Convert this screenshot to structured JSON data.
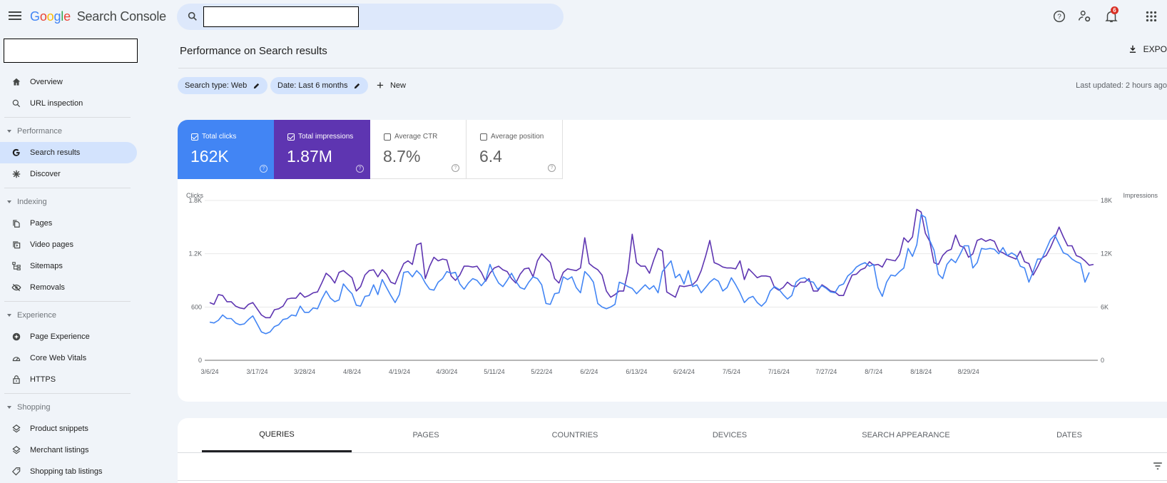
{
  "app": {
    "logo_letters": [
      "G",
      "o",
      "o",
      "g",
      "l",
      "e"
    ],
    "product_name": "Search Console",
    "search_placeholder": "",
    "notification_count": "6"
  },
  "icons": {
    "menu": "hamburger-menu-icon",
    "search": "search-icon",
    "help": "help-circle-icon",
    "account_settings": "account-settings-icon",
    "notifications": "bell-icon",
    "apps": "apps-grid-icon"
  },
  "sidebar": {
    "property_selector_value": "",
    "groups": [
      {
        "section": null,
        "items": [
          {
            "label": "Overview",
            "icon": "home-icon"
          },
          {
            "label": "URL inspection",
            "icon": "search-icon"
          }
        ]
      },
      {
        "section": "Performance",
        "items": [
          {
            "label": "Search results",
            "icon": "google-g-icon",
            "active": true
          },
          {
            "label": "Discover",
            "icon": "asterisk-icon"
          }
        ]
      },
      {
        "section": "Indexing",
        "items": [
          {
            "label": "Pages",
            "icon": "pages-icon"
          },
          {
            "label": "Video pages",
            "icon": "video-pages-icon"
          },
          {
            "label": "Sitemaps",
            "icon": "sitemap-icon"
          },
          {
            "label": "Removals",
            "icon": "eye-off-icon"
          }
        ]
      },
      {
        "section": "Experience",
        "items": [
          {
            "label": "Page Experience",
            "icon": "page-experience-icon"
          },
          {
            "label": "Core Web Vitals",
            "icon": "gauge-icon"
          },
          {
            "label": "HTTPS",
            "icon": "lock-icon"
          }
        ]
      },
      {
        "section": "Shopping",
        "items": [
          {
            "label": "Product snippets",
            "icon": "layers-icon"
          },
          {
            "label": "Merchant listings",
            "icon": "layers-icon"
          },
          {
            "label": "Shopping tab listings",
            "icon": "tag-icon"
          }
        ]
      }
    ]
  },
  "header": {
    "title": "Performance on Search results",
    "export_label": "EXPO",
    "last_updated": "Last updated: 2 hours ago"
  },
  "filters": {
    "chips": [
      {
        "label": "Search type: Web"
      },
      {
        "label": "Date: Last 6 months"
      }
    ],
    "new_label": "New"
  },
  "metrics": [
    {
      "label": "Total clicks",
      "value": "162K",
      "checked": true,
      "color": "#4285f4"
    },
    {
      "label": "Total impressions",
      "value": "1.87M",
      "checked": true,
      "color": "#5e35b1"
    },
    {
      "label": "Average CTR",
      "value": "8.7%",
      "checked": false
    },
    {
      "label": "Average position",
      "value": "6.4",
      "checked": false
    }
  ],
  "chart_data": {
    "type": "line",
    "title": "",
    "y_left_label": "Clicks",
    "y_right_label": "Impressions",
    "y_left_ticks": [
      "0",
      "600",
      "1.2K",
      "1.8K"
    ],
    "y_right_ticks": [
      "0",
      "6K",
      "12K",
      "18K"
    ],
    "ylim_left": [
      0,
      1800
    ],
    "ylim_right": [
      0,
      18000
    ],
    "x_tick_labels": [
      "3/6/24",
      "3/17/24",
      "3/28/24",
      "4/8/24",
      "4/19/24",
      "4/30/24",
      "5/11/24",
      "5/22/24",
      "6/2/24",
      "6/13/24",
      "6/24/24",
      "7/5/24",
      "7/16/24",
      "7/27/24",
      "8/7/24",
      "8/18/24",
      "8/29/24"
    ],
    "x_start": "3/6/24",
    "grid": true,
    "series": [
      {
        "name": "Clicks",
        "axis": "left",
        "color": "#4285f4",
        "values": [
          430,
          420,
          450,
          510,
          470,
          470,
          420,
          400,
          410,
          460,
          500,
          410,
          320,
          300,
          320,
          380,
          400,
          460,
          470,
          510,
          500,
          610,
          540,
          540,
          590,
          580,
          690,
          780,
          700,
          660,
          680,
          860,
          800,
          750,
          620,
          610,
          720,
          730,
          850,
          740,
          910,
          820,
          730,
          650,
          740,
          990,
          1000,
          940,
          1010,
          960,
          870,
          800,
          790,
          880,
          920,
          1000,
          980,
          990,
          860,
          800,
          870,
          920,
          900,
          840,
          900,
          1080,
          960,
          870,
          830,
          900,
          980,
          890,
          820,
          800,
          880,
          940,
          920,
          850,
          640,
          630,
          750,
          760,
          940,
          910,
          940,
          820,
          760,
          1000,
          950,
          880,
          640,
          600,
          580,
          600,
          630,
          880,
          860,
          830,
          810,
          750,
          800,
          850,
          800,
          840,
          760,
          1000,
          1060,
          1120,
          930,
          970,
          860,
          1010,
          830,
          850,
          760,
          820,
          880,
          920,
          890,
          780,
          820,
          930,
          850,
          760,
          650,
          700,
          720,
          650,
          610,
          660,
          780,
          830,
          800,
          740,
          690,
          730,
          880,
          920,
          930,
          890,
          880,
          800,
          840,
          810,
          770,
          760,
          840,
          860,
          950,
          990,
          1050,
          1080,
          1100,
          1060,
          1080,
          820,
          720,
          880,
          960,
          950,
          1000,
          1040,
          1260,
          1170,
          1300,
          1640,
          1610,
          1350,
          1240,
          970,
          920,
          1080,
          1140,
          1100,
          1190,
          1290,
          1290,
          1040,
          1100,
          1260,
          1250,
          1260,
          1250,
          1200,
          1270,
          1180,
          1210,
          1180,
          1060,
          1040,
          880,
          1000,
          1140,
          1140,
          1250,
          1360,
          1410,
          1310,
          1210,
          1190,
          1140,
          1110,
          1090,
          880,
          990
        ]
      },
      {
        "name": "Impressions",
        "axis": "right",
        "color": "#5e35b1",
        "values": [
          6500,
          6300,
          7400,
          7300,
          6600,
          6600,
          6100,
          5900,
          5800,
          6300,
          6500,
          5800,
          5100,
          4800,
          4800,
          5700,
          5800,
          6100,
          6900,
          7000,
          7000,
          7600,
          7100,
          7300,
          7600,
          7700,
          8700,
          9800,
          9400,
          8700,
          9900,
          10100,
          9700,
          9300,
          7800,
          8300,
          9600,
          10100,
          10200,
          9400,
          10200,
          9700,
          8800,
          8600,
          9800,
          10900,
          11200,
          10800,
          13000,
          13200,
          9200,
          10600,
          11600,
          11200,
          11400,
          11300,
          9500,
          9000,
          9600,
          10600,
          10600,
          10500,
          10600,
          9900,
          8900,
          9800,
          10400,
          10600,
          10200,
          10000,
          9200,
          8700,
          9700,
          10300,
          10400,
          9400,
          11200,
          12000,
          11500,
          11000,
          9200,
          8700,
          9900,
          10300,
          10200,
          10100,
          10400,
          13800,
          10900,
          10500,
          10200,
          9600,
          7800,
          7100,
          7400,
          7800,
          7800,
          10000,
          14200,
          11000,
          10600,
          10600,
          9800,
          11300,
          12600,
          12300,
          7700,
          7400,
          7100,
          8400,
          8300,
          8400,
          8500,
          9000,
          10100,
          11700,
          13500,
          11000,
          10800,
          10500,
          10400,
          10400,
          10300,
          11200,
          9100,
          10300,
          9800,
          9300,
          9500,
          9500,
          9400,
          8200,
          7900,
          8200,
          8800,
          8400,
          8300,
          8800,
          8800,
          9200,
          7800,
          7800,
          8500,
          8200,
          7800,
          7700,
          7300,
          7300,
          8500,
          9600,
          9700,
          10200,
          10400,
          11100,
          10700,
          10800,
          10500,
          11400,
          11300,
          11200,
          11900,
          13800,
          13300,
          13900,
          17000,
          16700,
          14300,
          13400,
          11000,
          10800,
          11800,
          12300,
          12500,
          14100,
          12900,
          12700,
          11600,
          12000,
          13500,
          13700,
          13400,
          13600,
          13400,
          12300,
          12100,
          11800,
          11600,
          11400,
          12300,
          11100,
          10900,
          9600,
          10500,
          11500,
          11800,
          12700,
          13800,
          15000,
          13900,
          12900,
          12900,
          11800,
          11600,
          11200,
          10700,
          10800
        ]
      }
    ]
  },
  "tabs": {
    "items": [
      {
        "label": "QUERIES",
        "active": true
      },
      {
        "label": "PAGES"
      },
      {
        "label": "COUNTRIES"
      },
      {
        "label": "DEVICES"
      },
      {
        "label": "SEARCH APPEARANCE"
      },
      {
        "label": "DATES"
      }
    ]
  }
}
